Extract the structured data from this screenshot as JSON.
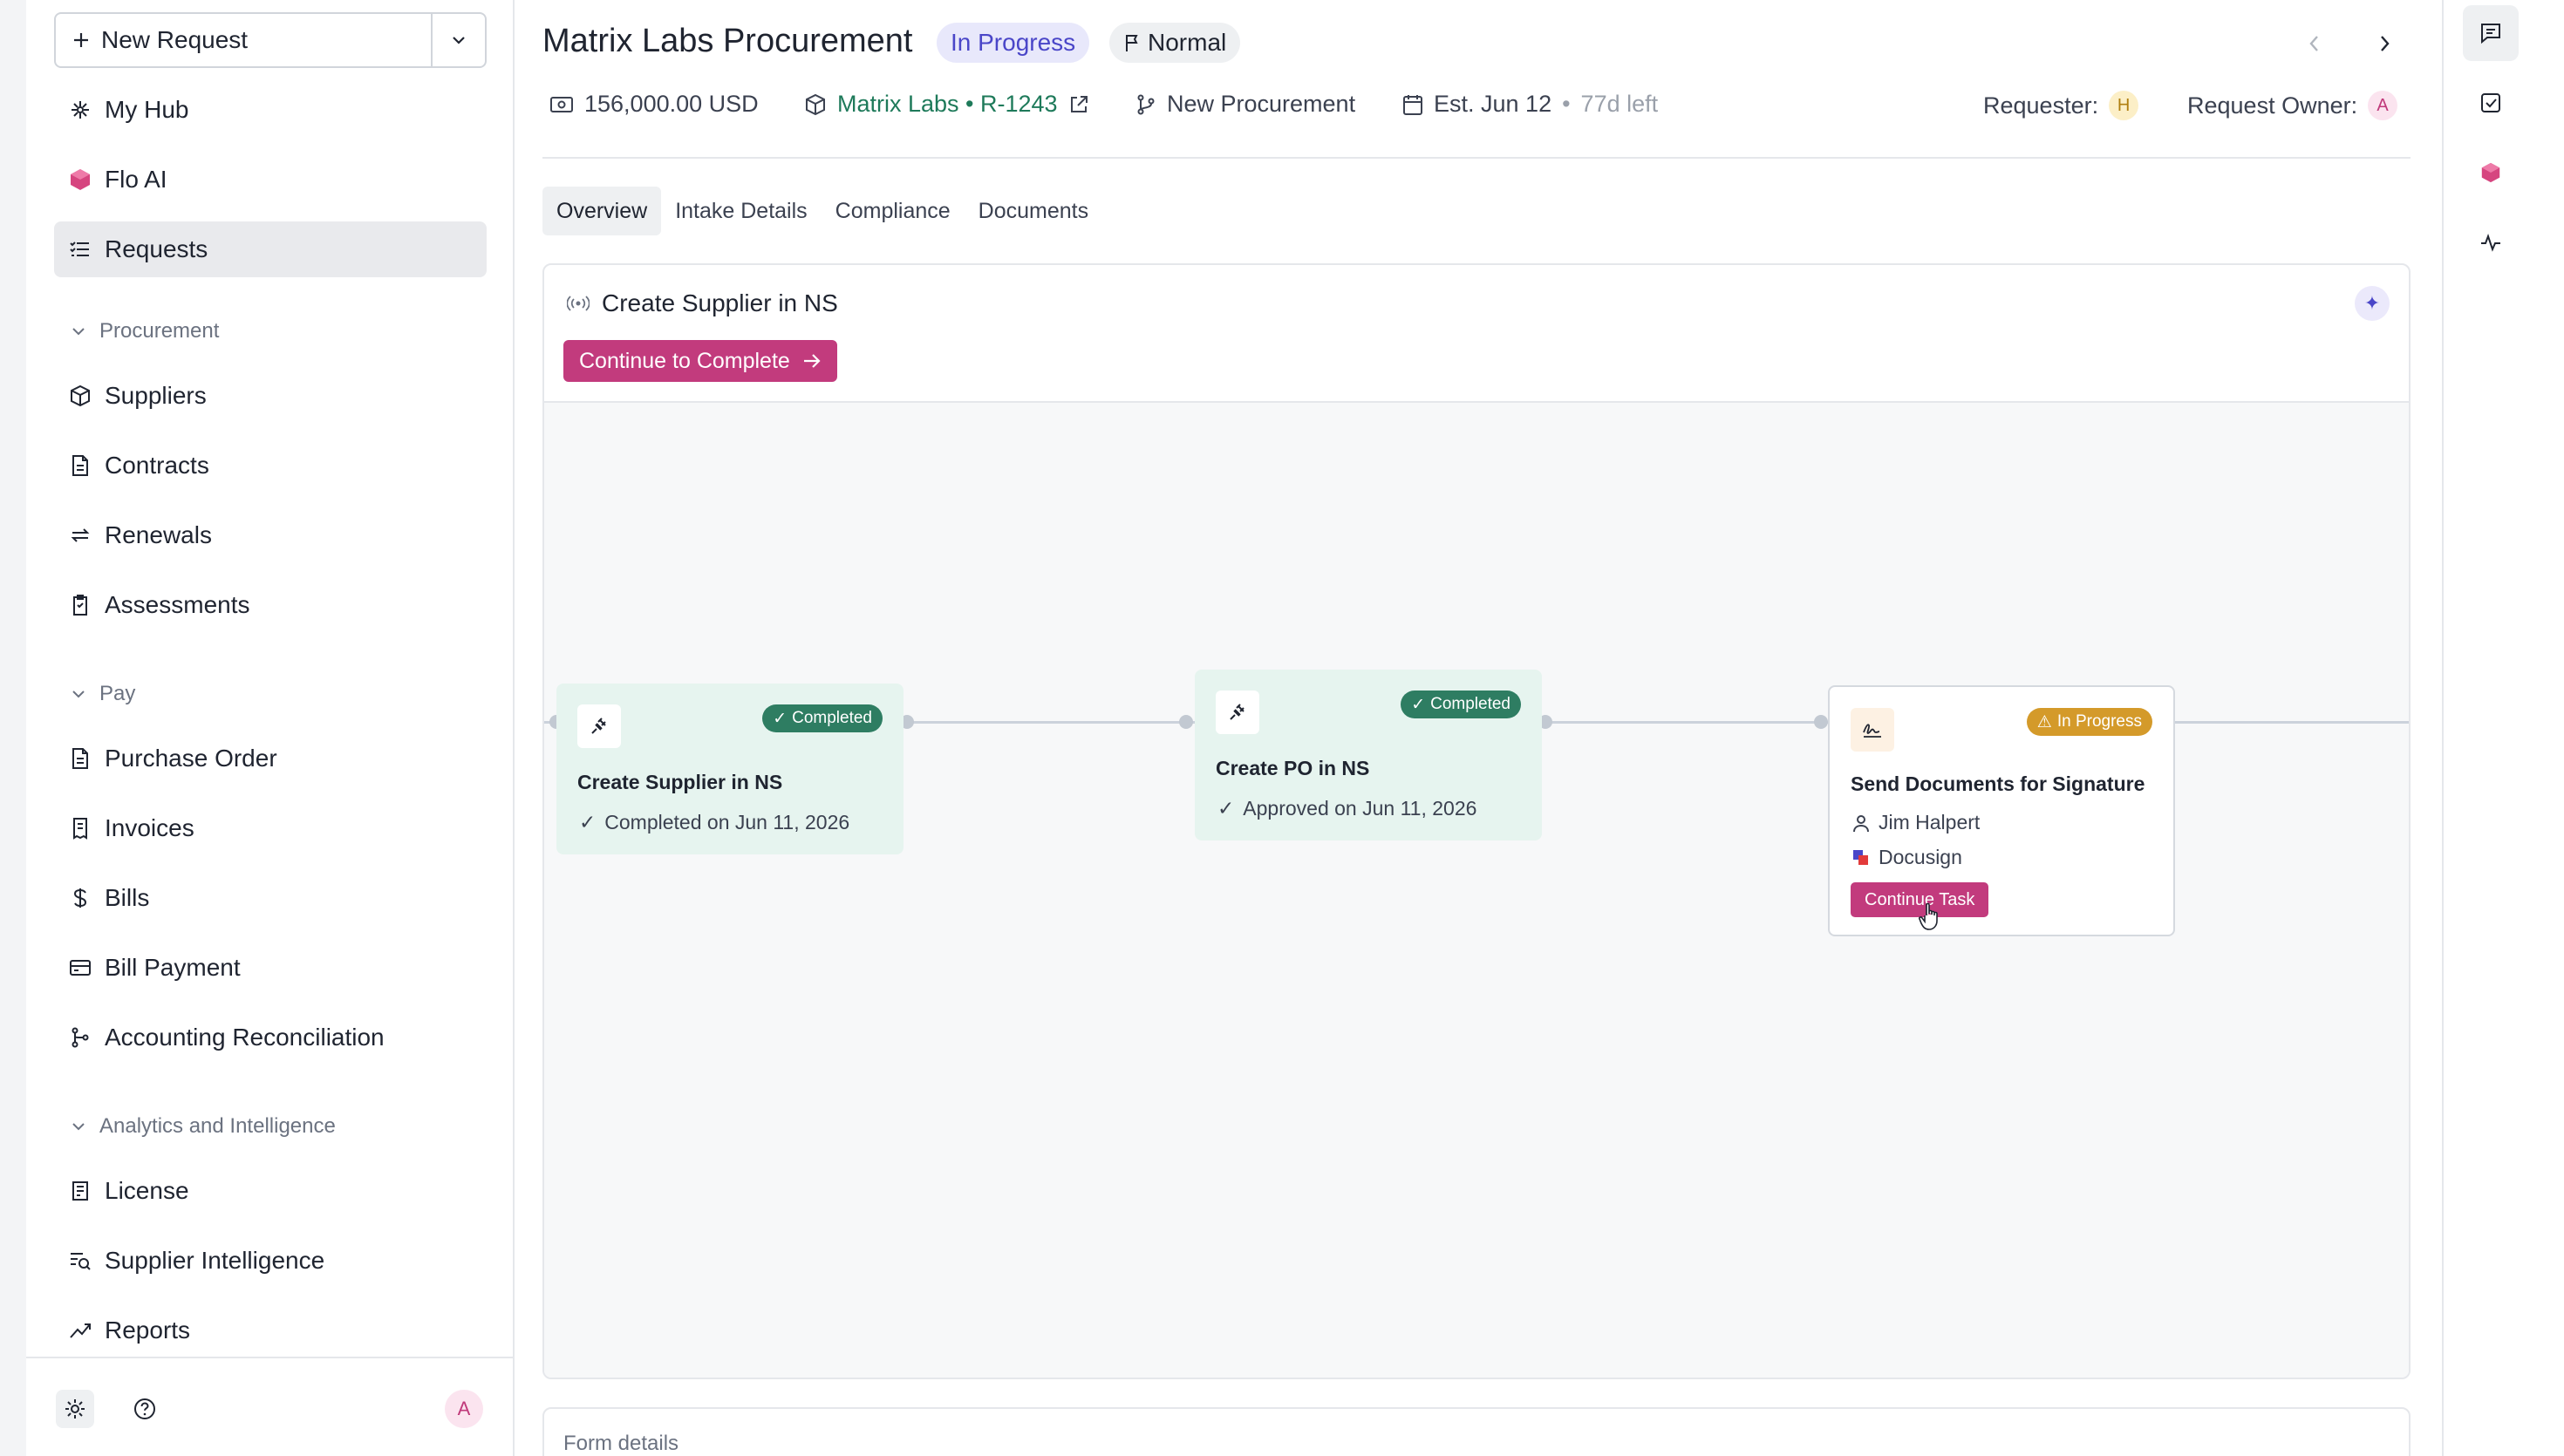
{
  "sidebar": {
    "new_request": "New Request",
    "top_items": [
      {
        "label": "My Hub",
        "icon": "hub-icon"
      },
      {
        "label": "Flo AI",
        "icon": "flo-ai-icon"
      },
      {
        "label": "Requests",
        "icon": "list-icon",
        "active": true
      }
    ],
    "sections": [
      {
        "title": "Procurement",
        "items": [
          {
            "label": "Suppliers",
            "icon": "box-icon"
          },
          {
            "label": "Contracts",
            "icon": "document-icon"
          },
          {
            "label": "Renewals",
            "icon": "repeat-icon"
          },
          {
            "label": "Assessments",
            "icon": "clipboard-icon"
          }
        ]
      },
      {
        "title": "Pay",
        "items": [
          {
            "label": "Purchase Order",
            "icon": "document-icon"
          },
          {
            "label": "Invoices",
            "icon": "receipt-icon"
          },
          {
            "label": "Bills",
            "icon": "dollar-icon"
          },
          {
            "label": "Bill Payment",
            "icon": "card-icon"
          },
          {
            "label": "Accounting Reconciliation",
            "icon": "branch-icon"
          }
        ]
      },
      {
        "title": "Analytics and Intelligence",
        "items": [
          {
            "label": "License",
            "icon": "license-icon"
          },
          {
            "label": "Supplier Intelligence",
            "icon": "search-list-icon"
          },
          {
            "label": "Reports",
            "icon": "trend-icon"
          }
        ]
      }
    ],
    "footer": {
      "avatar": "A"
    }
  },
  "header": {
    "title": "Matrix Labs Procurement",
    "status": "In Progress",
    "priority": "Normal",
    "amount": "156,000.00 USD",
    "supplier_link": "Matrix Labs • R-1243",
    "type": "New Procurement",
    "est_date": "Est. Jun 12",
    "bullet": "•",
    "time_left": "77d left",
    "requester_label": "Requester:",
    "requester_avatar": "H",
    "owner_label": "Request Owner:",
    "owner_avatar": "A"
  },
  "tabs": [
    "Overview",
    "Intake Details",
    "Compliance",
    "Documents"
  ],
  "flow": {
    "current_step": "Create Supplier in NS",
    "cta": "Continue to Complete",
    "steps": [
      {
        "title": "Create Supplier in NS",
        "badge": "Completed",
        "detail": "Completed on Jun 11, 2026"
      },
      {
        "title": "Create PO in NS",
        "badge": "Completed",
        "detail": "Approved on Jun 11, 2026"
      },
      {
        "title": "Send Documents for Signature",
        "badge": "In Progress",
        "assignee": "Jim Halpert",
        "integration": "Docusign",
        "button": "Continue Task"
      }
    ]
  },
  "form_details": "Form details",
  "colors": {
    "accent": "#c23b7d",
    "status_bg": "#e8e8fb",
    "completed": "#2e7d62",
    "warn": "#d49a2a"
  }
}
